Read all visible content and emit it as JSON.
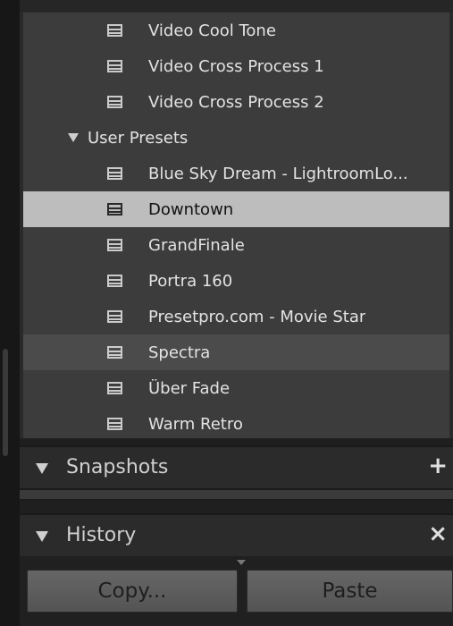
{
  "presets": {
    "rows": [
      {
        "label": "Video Cool Tone"
      },
      {
        "label": "Video Cross Process 1"
      },
      {
        "label": "Video Cross Process 2"
      },
      {
        "label": "User Presets"
      },
      {
        "label": "Blue Sky Dream - LightroomLo..."
      },
      {
        "label": "Downtown"
      },
      {
        "label": "GrandFinale"
      },
      {
        "label": "Portra 160"
      },
      {
        "label": "Presetpro.com - Movie Star"
      },
      {
        "label": "Spectra"
      },
      {
        "label": "Über Fade"
      },
      {
        "label": "Warm Retro"
      }
    ]
  },
  "snapshots": {
    "title": "Snapshots",
    "action": "+"
  },
  "history": {
    "title": "History",
    "action": "×"
  },
  "buttons": {
    "copy": "Copy...",
    "paste": "Paste"
  },
  "colors": {
    "selected": "#bdbdbd",
    "panel": "#3c3c3c",
    "header": "#2b2b2b"
  }
}
